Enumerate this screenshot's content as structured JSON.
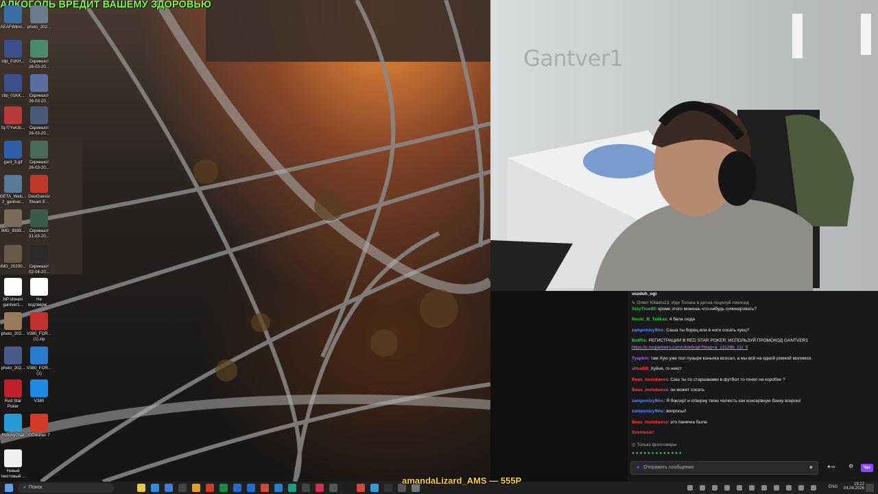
{
  "overlay": {
    "warning_text": "АЛКОГОЛЬ ВРЕДИТ ВАШЕМУ ЗДОРОВЬЮ",
    "banner_text": "amandaLizard_AMS — 555P"
  },
  "desktop_icons": [
    {
      "label": "AEAFWtmc...",
      "color": "#3a6ea5"
    },
    {
      "label": "photo_202...",
      "color": "#6a7b8c"
    },
    {
      "label": "clip_01KH...",
      "color": "#3d4f8a"
    },
    {
      "label": "Скриншот\n26-03-20...",
      "color": "#4e8a6a"
    },
    {
      "label": "clip_01KK...",
      "color": "#3d4f8a"
    },
    {
      "label": "Скриншот\n26-03-20...",
      "color": "#5a6ea0"
    },
    {
      "label": "fq-f7YwUb...",
      "color": "#b83a3a"
    },
    {
      "label": "Скриншот\n26-03-20...",
      "color": "#4a5a7a"
    },
    {
      "label": "gant_3.gif",
      "color": "#2f5fa8"
    },
    {
      "label": "Скриншот\n26-03-20...",
      "color": "#4a6a5a"
    },
    {
      "label": "GETA_Welc...\n2_gantver...",
      "color": "#5a7a9a"
    },
    {
      "label": "GeoGuessr\nSteam E...",
      "color": "#c0392b"
    },
    {
      "label": "IMG_9939...",
      "color": "#7a6a5a"
    },
    {
      "label": "Скриншот\n31-03-20...",
      "color": "#3a5a4a"
    },
    {
      "label": "IMG_20200...",
      "color": "#6a5a4a"
    },
    {
      "label": "Скриншот\n02-04-20...",
      "color": "#2a2a2a"
    },
    {
      "label": "NP stream\ngantver1...",
      "color": "#ffffff"
    },
    {
      "label": "Не\nподтверж...",
      "color": "#ffffff"
    },
    {
      "label": "photo_202...",
      "color": "#9a7a5a"
    },
    {
      "label": "V380_FOR...\n(1).zip",
      "color": "#c23030"
    },
    {
      "label": "photo_202...",
      "color": "#4a5a8a"
    },
    {
      "label": "V380_FOR...\n(1)",
      "color": "#2a7ad0"
    },
    {
      "label": "Red Star\nPoker",
      "color": "#c0202a"
    },
    {
      "label": "V380",
      "color": "#1f8ae0"
    },
    {
      "label": "RutonyChat",
      "color": "#2a9ad6"
    },
    {
      "label": "CCleaner 7",
      "color": "#d23a2a"
    },
    {
      "label": "Новый\nтекстовый ...",
      "color": "#f0f0f0"
    }
  ],
  "webcam": {
    "wall_logo": "Gantver1"
  },
  "chat": {
    "reply_context": "Ответ K8aets23: Иди Толика в десна поцелуй гомосед",
    "messages": [
      {
        "user": "vozduh_ogr",
        "text": "",
        "color": "#ffffff"
      },
      {
        "user": "StayTrue89",
        "text": ": кроме этого можешь что-нибудь сочинировать?",
        "color": "#2ecc40"
      },
      {
        "user": "Noski_B_Tallkax",
        "text": ": 4 бала сюда",
        "color": "#2ecc40"
      },
      {
        "user": "zamponixy9inc",
        "text": ": Саша ты борец или в ноги сосать хуец?",
        "color": "#5b8cff"
      },
      {
        "user": "BotRix",
        "text": ": РЕГИСТРАЦИИ В RED STAR POKER. ИСПОЛЬЗУЙ ПРОМОКОД GANTVER1",
        "color": "#2ecc40"
      },
      {
        "user": "",
        "text": "https://c.rsopartners.com/clickthrgh?btag=a_13129b_21l_9",
        "color": "#bf94ff"
      },
      {
        "user": "Tyapkin",
        "text": ": там Хую уже пол пузыря коньяка всосал, а мы всё на одной ромкой молимся.",
        "color": "#b05cff"
      },
      {
        "user": "slmalll8",
        "text": ": Хуйня, го некст",
        "color": "#ff4040"
      },
      {
        "user": "Beas_molokeess",
        "text": ": Саш ты со старшаками в футбол то гонял на коробке ?",
        "color": "#ff4040"
      },
      {
        "user": "Beas_molokeess",
        "text": ": он может сосать",
        "color": "#ff4040"
      },
      {
        "user": "zamponixy9inc",
        "text": ": Я боксер! и отверну твою челюсть как консервную банку вскрою!",
        "color": "#5b8cff"
      },
      {
        "user": "zamponixy9inc",
        "text": ": вопросы/!",
        "color": "#5b8cff"
      },
      {
        "user": "Beas_molokeess",
        "text": ": это панечка была",
        "color": "#ff4040"
      },
      {
        "user": "Svenlasor",
        "text": ":",
        "color": "#ff4040"
      }
    ],
    "followers_only": "Только фолловеры",
    "input_placeholder": "Отправить сообщение",
    "send_label": "Чат"
  },
  "taskbar": {
    "search_placeholder": "Поиск",
    "language": "ENG",
    "time": "19:22",
    "date": "04.04.2026"
  }
}
